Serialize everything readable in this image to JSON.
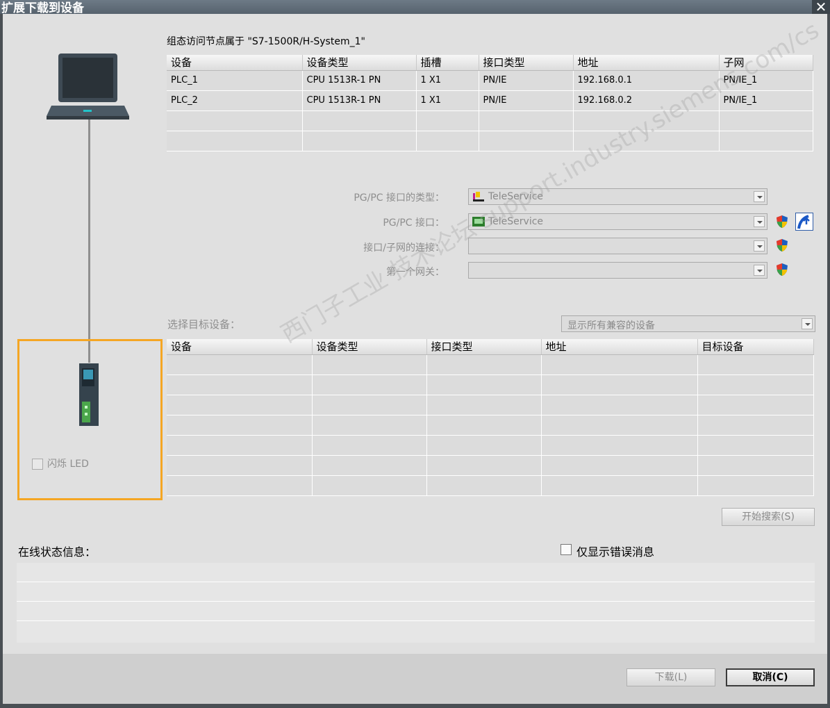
{
  "window": {
    "title": "扩展下载到设备",
    "close": "✕"
  },
  "config_label": "组态访问节点属于 \"S7-1500R/H-System_1\"",
  "access_table": {
    "headers": [
      "设备",
      "设备类型",
      "插槽",
      "接口类型",
      "地址",
      "子网"
    ],
    "rows": [
      [
        "PLC_1",
        "CPU 1513R-1 PN",
        "1 X1",
        "PN/IE",
        "192.168.0.1",
        "PN/IE_1"
      ],
      [
        "PLC_2",
        "CPU 1513R-1 PN",
        "1 X1",
        "PN/IE",
        "192.168.0.2",
        "PN/IE_1"
      ],
      [
        "",
        "",
        "",
        "",
        "",
        ""
      ],
      [
        "",
        "",
        "",
        "",
        "",
        ""
      ]
    ]
  },
  "interface": {
    "type_label": "PG/PC 接口的类型：",
    "type_value": "TeleService",
    "pgpc_label": "PG/PC 接口：",
    "pgpc_value": "TeleService",
    "subnet_label": "接口/子网的连接：",
    "subnet_value": "",
    "gateway_label": "第一个网关：",
    "gateway_value": ""
  },
  "target": {
    "label": "选择目标设备：",
    "filter_value": "显示所有兼容的设备",
    "headers": [
      "设备",
      "设备类型",
      "接口类型",
      "地址",
      "目标设备"
    ],
    "row_count": 7
  },
  "flash_led_label": "闪烁 LED",
  "search_button": "开始搜索(S)",
  "online_status_label": "在线状态信息：",
  "errors_only_label": "仅显示错误消息",
  "download_button": "下载(L)",
  "cancel_button": "取消(C)",
  "watermark": "西门子工业 技术论坛 support.industry.siemens.com/cs",
  "colors": {
    "accent": "#f5a623",
    "titlebar": "#5f6b76",
    "body": "#e0e0e0"
  }
}
